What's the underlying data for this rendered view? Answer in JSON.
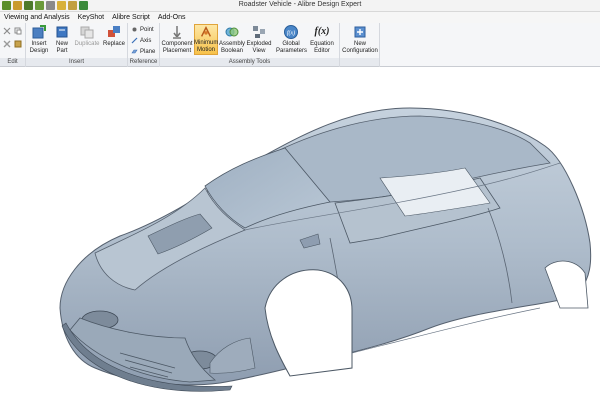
{
  "window": {
    "title": "Roadster Vehicle - Alibre Design Expert"
  },
  "menu": {
    "items": [
      "Viewing and Analysis",
      "KeyShot",
      "Alibre Script",
      "Add-Ons"
    ]
  },
  "ribbon": {
    "groups": {
      "edit": "Edit",
      "insert": "Insert",
      "reference": "Reference",
      "assembly_tools": "Assembly Tools"
    },
    "buttons": {
      "insert_design": "Insert Design",
      "new_part": "New Part",
      "duplicate": "Duplicate",
      "replace": "Replace",
      "point": "Point",
      "axis": "Axis",
      "plane": "Plane",
      "component_placement": "Component Placement",
      "minimum_motion": "Minimum Motion",
      "assembly_boolean": "Assembly Boolean",
      "exploded_view": "Exploded View",
      "global_parameters": "Global Parameters",
      "equation_editor": "Equation Editor",
      "new_configuration": "New Configuration"
    },
    "equation_icon_text": "f(x)"
  },
  "colors": {
    "ribbon_bg": "#f5f6f8",
    "active_tool": "#f7c24a",
    "car_body": "#aebccb",
    "car_shadow": "#7f8fa1",
    "viewport_bg": "#ffffff"
  }
}
